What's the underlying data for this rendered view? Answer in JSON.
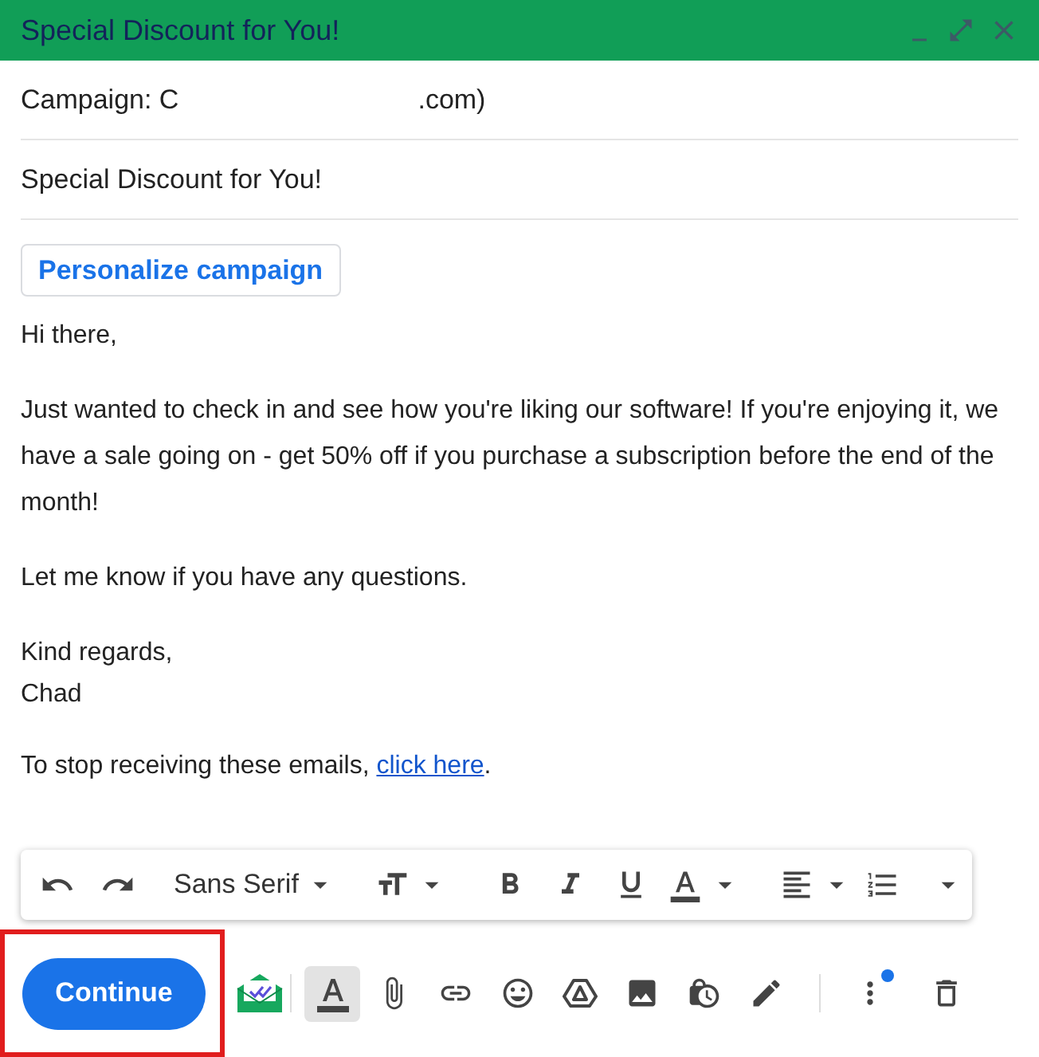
{
  "window": {
    "title": "Special Discount for You!"
  },
  "campaign": {
    "prefix": "Campaign: C",
    "suffix": ".com)"
  },
  "subject": "Special Discount for You!",
  "personalize_button": "Personalize campaign",
  "body": {
    "paragraphs": [
      [
        "Hi there,"
      ],
      [
        "Just wanted to check in and see how you're liking our software! If you're enjoying it, we have a sale going on - get 50% off if you purchase a subscription before the end of the month!"
      ],
      [
        "Let me know if you have any questions."
      ],
      [
        "Kind regards,",
        "Chad"
      ]
    ],
    "unsubscribe": {
      "text": "To stop receiving these emails, ",
      "link": "click here",
      "after": "."
    }
  },
  "formatting_toolbar": {
    "font": "Sans Serif"
  },
  "actions": {
    "send_button": "Continue",
    "highlighted": true,
    "formatting_selected": true,
    "more_notification": true
  }
}
